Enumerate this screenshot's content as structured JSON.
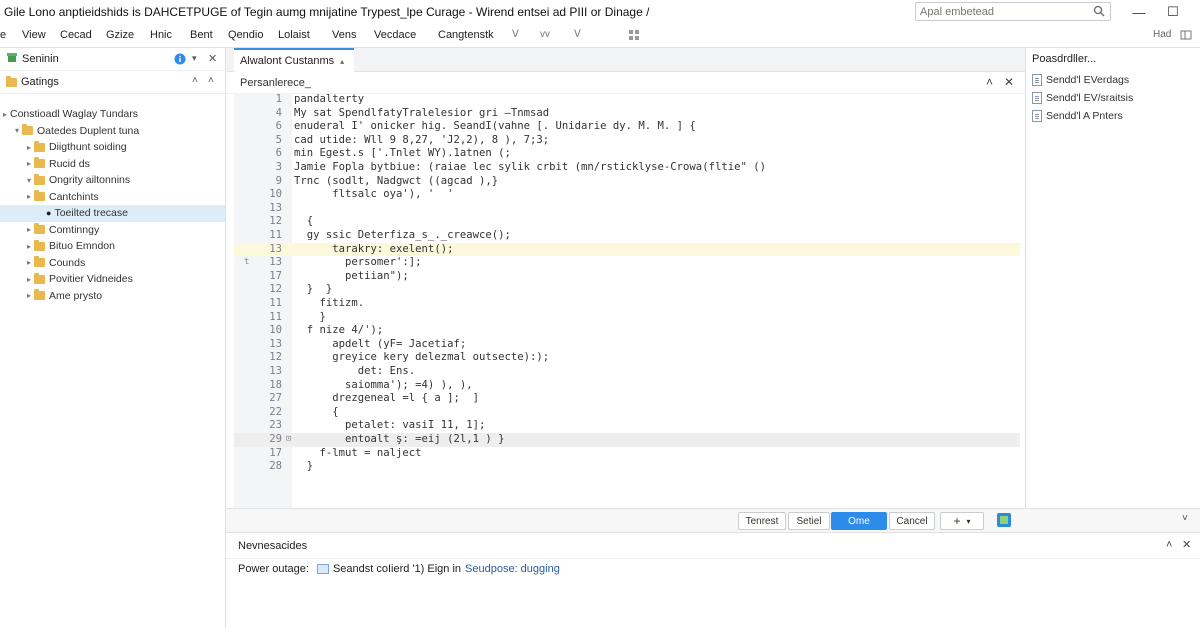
{
  "window": {
    "title": "Gile Lono anptieidshids is DAHCETPUGE of Tegin aumg mnijatine Trypest_lpe Curage - Wirend entsei ad PIII or Dinage /",
    "search_placeholder": "Apal embetead",
    "minimize": "—",
    "maximize": "☐"
  },
  "menu": {
    "items": [
      "e",
      "View",
      "Cecad",
      "Gzize",
      "Hnic",
      "Bent",
      "Qendio",
      "Lolaist",
      "Vens",
      "Vecdace",
      "Cangtenstk"
    ],
    "icon_labels": [
      "ᐯ",
      "vv",
      "ᐯ"
    ],
    "right_label": "Had"
  },
  "sidebar": {
    "header_title": "Seninin",
    "section_title": "Gatings",
    "tree": [
      {
        "label": "Constioadl Waglay Tundars",
        "depth": 0,
        "caret": "▸",
        "folder": false
      },
      {
        "label": "Oatedes Duplent tuna",
        "depth": 1,
        "caret": "▾",
        "folder": true
      },
      {
        "label": "Diigthunt soiding",
        "depth": 2,
        "caret": "▸",
        "folder": true
      },
      {
        "label": "Rucid ds",
        "depth": 2,
        "caret": "▸",
        "folder": true
      },
      {
        "label": "Ongrity ailtonnins",
        "depth": 2,
        "caret": "▾",
        "folder": true
      },
      {
        "label": "Cantchints",
        "depth": 2,
        "caret": "▸",
        "folder": true
      },
      {
        "label": "Toeilted trecase",
        "depth": 3,
        "caret": "",
        "folder": false,
        "selected": true
      },
      {
        "label": "Comtinngy",
        "depth": 2,
        "caret": "▸",
        "folder": true
      },
      {
        "label": "Bituo Emndon",
        "depth": 2,
        "caret": "▸",
        "folder": true
      },
      {
        "label": "Counds",
        "depth": 2,
        "caret": "▸",
        "folder": true
      },
      {
        "label": "Povitier Vidneides",
        "depth": 2,
        "caret": "▸",
        "folder": true
      },
      {
        "label": "Ame prysto",
        "depth": 2,
        "caret": "▸",
        "folder": true
      }
    ]
  },
  "editor": {
    "tab_label": "Alwalont Custanms",
    "breadcrumb": "Persanlerece_",
    "lines": [
      {
        "n": "1",
        "t": "pandalterty"
      },
      {
        "n": "4",
        "t": "My sat SpendlfatyTralelesior gri —Tnmsad"
      },
      {
        "n": "6",
        "t": "enuderal I' onicker hig. SeandI(vahne [. Unidarie dy. M. M. ] {"
      },
      {
        "n": "5",
        "t": "cad utide: Wll 9 8,27, 'J2,2), 8 ), 7;3;"
      },
      {
        "n": "6",
        "t": "min Egest.s ['.Tnlet WY).1atnen (;"
      },
      {
        "n": "3",
        "t": "Jamie Fopla bytbiue: (raiae lec sylik crbit (mn/rsticklyse-Crowa(fltie\" ()"
      },
      {
        "n": "9",
        "t": "Trnc (sodlt, Nadgwct ((agcad ),}"
      },
      {
        "n": "10",
        "t": "      fltsalc oya'), '  '"
      },
      {
        "n": "13",
        "t": ""
      },
      {
        "n": "12",
        "t": "  {"
      },
      {
        "n": "11",
        "t": "  gy ssic Deterfiza_s_._creawce();"
      },
      {
        "n": "13",
        "t": "      tarakry: exelent();",
        "hl": true
      },
      {
        "n": "13",
        "t": "        persomer':];"
      },
      {
        "n": "17",
        "t": "        petiian\");"
      },
      {
        "n": "12",
        "t": "  }  }"
      },
      {
        "n": "11",
        "t": "    fitizm."
      },
      {
        "n": "11",
        "t": "    }"
      },
      {
        "n": "10",
        "t": "  f nize 4/');"
      },
      {
        "n": "13",
        "t": "      apdelt (yF= Jacetiaf;"
      },
      {
        "n": "12",
        "t": "      greyice kery delezmal outsecte):);"
      },
      {
        "n": "13",
        "t": "          det: Ens."
      },
      {
        "n": "18",
        "t": "        saiomma'); =4) ), ),"
      },
      {
        "n": "27",
        "t": "      drezgeneal =l { a ];  ]"
      },
      {
        "n": "22",
        "t": "      {"
      },
      {
        "n": "23",
        "t": "        petalet: vasiI 11, 1];"
      },
      {
        "n": "29",
        "t": "        entoalt ş: =eij (2l,1 ) }",
        "cur": true
      },
      {
        "n": "17",
        "t": "    f-lmut = nalject"
      },
      {
        "n": "28",
        "t": "  }"
      }
    ],
    "gutter_marks": [
      {
        "line": 13,
        "mark": "t"
      },
      {
        "line": 26,
        "mark": "⊡"
      }
    ]
  },
  "actions": {
    "button1": "Tenrest",
    "button2": "Setiel",
    "button3": "Ome",
    "button4": "Cancel",
    "button5": "+",
    "button5_chev": "▾"
  },
  "rightpanel": {
    "title": "Poasdrdller...",
    "items": [
      "Sendd'l EVerdags",
      "Sendd'l EV/sraitsis",
      "Sendd'l A Pnters"
    ]
  },
  "output": {
    "title": "Nevnesacides",
    "label": "Power outage:",
    "message_part1": "Seandst coIierd '1) Eign in",
    "message_part2": "Seudpose: dugging"
  },
  "colors": {
    "accent": "#2d8cea",
    "selected_bg": "#dcecf9",
    "folder": "#e9b94f"
  }
}
